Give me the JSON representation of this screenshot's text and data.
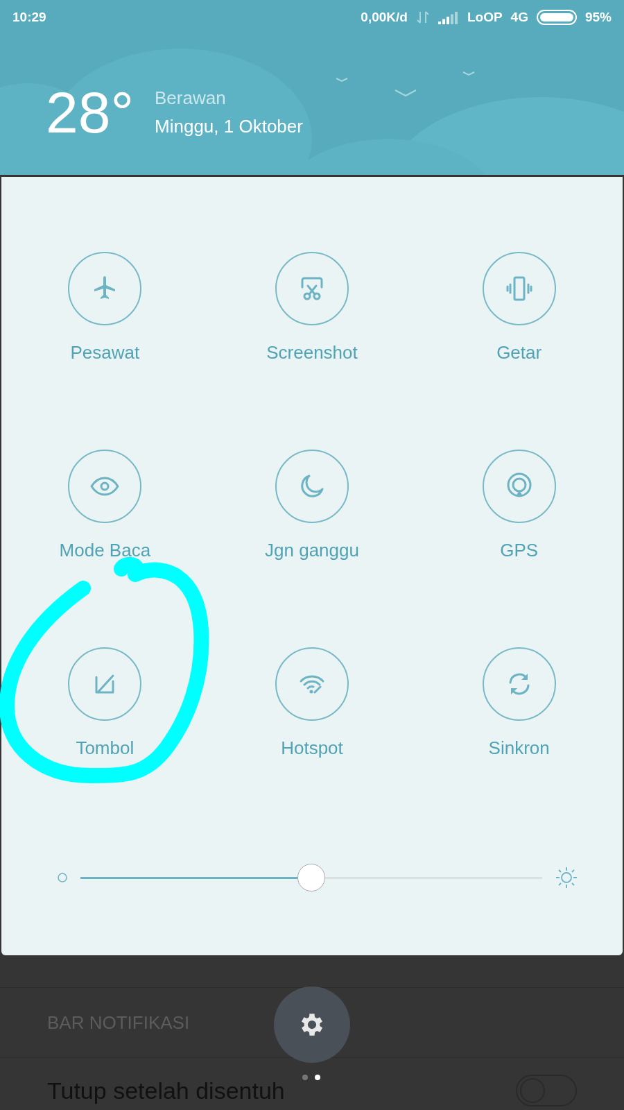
{
  "status_bar": {
    "time": "10:29",
    "speed": "0,00K/d",
    "carrier": "LoOP",
    "network": "4G",
    "battery": "95%"
  },
  "weather": {
    "temperature": "28°",
    "condition": "Berawan",
    "date": "Minggu, 1 Oktober"
  },
  "tiles": [
    {
      "kind": "airplane",
      "label": "Pesawat"
    },
    {
      "kind": "screenshot",
      "label": "Screenshot"
    },
    {
      "kind": "vibrate",
      "label": "Getar"
    },
    {
      "kind": "eye",
      "label": "Mode Baca"
    },
    {
      "kind": "moon",
      "label": "Jgn ganggu"
    },
    {
      "kind": "gps",
      "label": "GPS"
    },
    {
      "kind": "buttons",
      "label": "Tombol"
    },
    {
      "kind": "hotspot",
      "label": "Hotspot"
    },
    {
      "kind": "sync",
      "label": "Sinkron"
    }
  ],
  "brightness": {
    "level": 0.5
  },
  "background_settings": {
    "section": "BAR NOTIFIKASI",
    "row_label": "Tutup setelah disentuh",
    "toggle_on": false
  },
  "pages": [
    {
      "selected": false
    },
    {
      "selected": true
    }
  ]
}
